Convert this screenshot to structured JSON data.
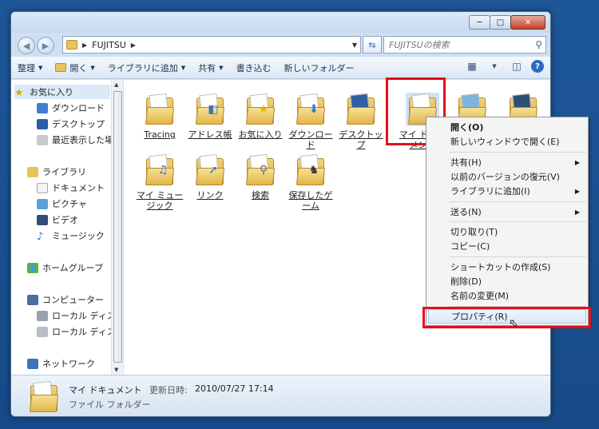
{
  "window": {
    "address_path": "FUJITSU",
    "search_placeholder": "FUJITSUの検索"
  },
  "toolbar": {
    "organize": "整理",
    "open": "開く",
    "add_to_library": "ライブラリに追加",
    "share": "共有",
    "burn": "書き込む",
    "new_folder": "新しいフォルダー"
  },
  "sidebar": {
    "favorites": "お気に入り",
    "downloads": "ダウンロード",
    "desktop": "デスクトップ",
    "recent": "最近表示した場所",
    "libraries": "ライブラリ",
    "documents": "ドキュメント",
    "pictures": "ピクチャ",
    "videos": "ビデオ",
    "music": "ミュージック",
    "homegroup": "ホームグループ",
    "computer": "コンピューター",
    "local_disk_1": "ローカル ディスク",
    "local_disk_2": "ローカル ディスク",
    "network": "ネットワーク"
  },
  "files": [
    {
      "label": "Tracing"
    },
    {
      "label": "アドレス帳"
    },
    {
      "label": "お気に入り"
    },
    {
      "label": "ダウンロード"
    },
    {
      "label": "デスクトップ"
    },
    {
      "label": "マイ ドキュメント"
    },
    {
      "label": ""
    },
    {
      "label": ""
    },
    {
      "label": "マイ ミュージック"
    },
    {
      "label": "リンク"
    },
    {
      "label": "検索"
    },
    {
      "label": "保存したゲーム"
    }
  ],
  "context_menu": {
    "open": "開く(O)",
    "open_new_window": "新しいウィンドウで開く(E)",
    "share": "共有(H)",
    "restore_previous": "以前のバージョンの復元(V)",
    "add_to_library": "ライブラリに追加(I)",
    "send_to": "送る(N)",
    "cut": "切り取り(T)",
    "copy": "コピー(C)",
    "create_shortcut": "ショートカットの作成(S)",
    "delete": "削除(D)",
    "rename": "名前の変更(M)",
    "properties": "プロパティ(R)"
  },
  "details": {
    "name": "マイ ドキュメント",
    "modified_label": "更新日時:",
    "modified": "2010/07/27 17:14",
    "type": "ファイル フォルダー"
  }
}
